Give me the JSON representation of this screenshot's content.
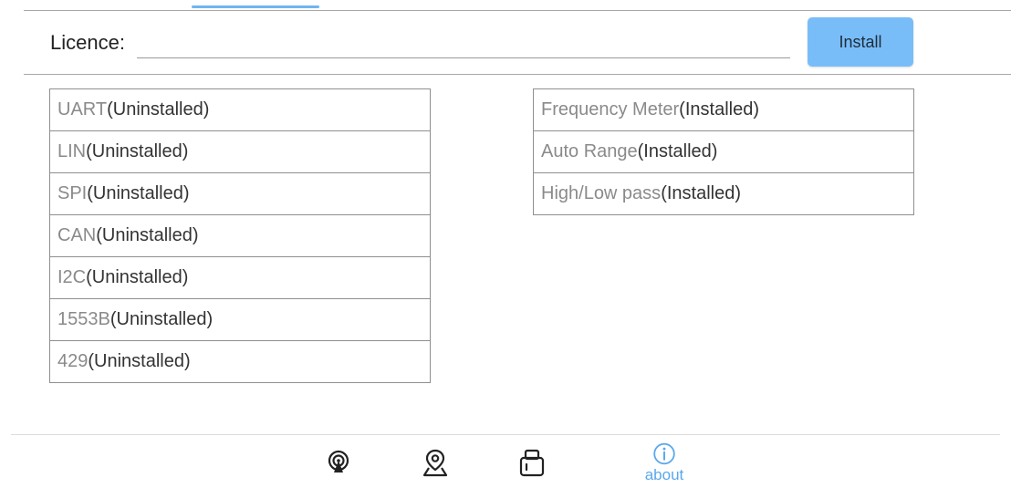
{
  "licence": {
    "label": "Licence:",
    "value": "",
    "placeholder": ""
  },
  "install_button": {
    "label": "Install"
  },
  "left_modules": [
    {
      "name": "UART",
      "status": "(Uninstalled)"
    },
    {
      "name": "LIN",
      "status": "(Uninstalled)"
    },
    {
      "name": "SPI",
      "status": "(Uninstalled)"
    },
    {
      "name": "CAN",
      "status": "(Uninstalled)"
    },
    {
      "name": "I2C",
      "status": "(Uninstalled)"
    },
    {
      "name": "1553B",
      "status": "(Uninstalled)"
    },
    {
      "name": "429",
      "status": "(Uninstalled)"
    }
  ],
  "right_modules": [
    {
      "name": "Frequency Meter",
      "status": "(Installed)"
    },
    {
      "name": "Auto Range",
      "status": "(Installed)"
    },
    {
      "name": "High/Low pass",
      "status": "(Installed)"
    }
  ],
  "bottom_nav": [
    {
      "icon": "wifi-signal-icon",
      "label": ""
    },
    {
      "icon": "location-pin-icon",
      "label": ""
    },
    {
      "icon": "device-icon",
      "label": ""
    },
    {
      "icon": "info-icon",
      "label": "about",
      "active": true
    }
  ],
  "colors": {
    "accent": "#79bdf8",
    "active_nav": "#5aa8ec",
    "module_name": "#8a8a8a",
    "module_status": "#333333"
  }
}
